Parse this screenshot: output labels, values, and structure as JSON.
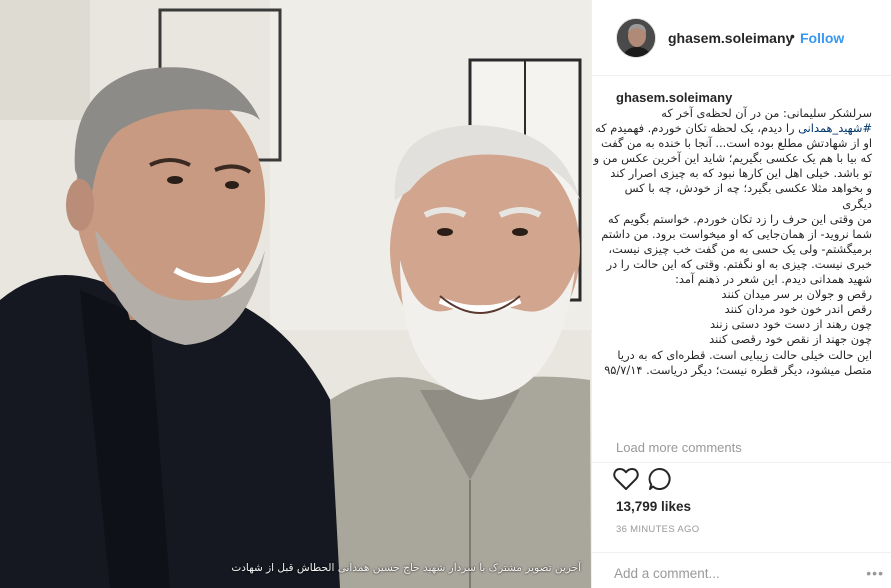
{
  "header": {
    "username": "ghasem.soleimany",
    "separator": "•",
    "follow_label": "Follow"
  },
  "post": {
    "photo_caption": "آخرین تصویر مشترک با سردار شهید حاج حسین همدانی الحطاش قبل از شهادت",
    "caption_username": "ghasem.soleimany",
    "caption_lines": [
      "سرلشکر سلیمانی: من در آن لحظه‌ی آخر که",
      "را دیدم، یک لحظه تکان خوردم. فهمیدم که",
      "او از شهادتش مطلع بوده است... آنجا با خنده به من گفت",
      "که بیا با هم یک عکسی بگیریم؛ شاید این آخرین عکس من و",
      "تو باشد. خیلی اهل این کارها نبود که به چیزی اصرار کند",
      "و بخواهد مثلا عکسی بگیرد؛ چه از خودش، چه با کس",
      "دیگری",
      "من وقتی این حرف را زد تکان خوردم. خواستم بگویم که",
      "شما نروید- از همان‌جایی که او میخواست برود. من داشتم",
      "برمیگشتم- ولی یک حسی به من گفت خب چیزی نیست،",
      "خبری نیست. چیزی به او نگفتم. وقتی که این حالت را در",
      "شهید همدانی دیدم. این شعر در ذهنم آمد:",
      "رقص و جولان بر سر میدان کنند",
      "رقص اندر خون خود مردان کنند",
      "چون رهند از دست خود دستی زنند",
      "چون جهند از نقص خود رقصی کنند",
      "این حالت خیلی حالت زیبایی است. قطره‌ای که به دریا",
      "متصل میشود، دیگر قطره نیست؛ دیگر دریاست. ۹۵/۷/۱۴"
    ],
    "hashtag": "#شهید_همدانی",
    "load_more": "Load more comments",
    "likes": "13,799 likes",
    "time": "36 MINUTES AGO",
    "comment_placeholder": "Add a comment...",
    "more": "•••"
  }
}
